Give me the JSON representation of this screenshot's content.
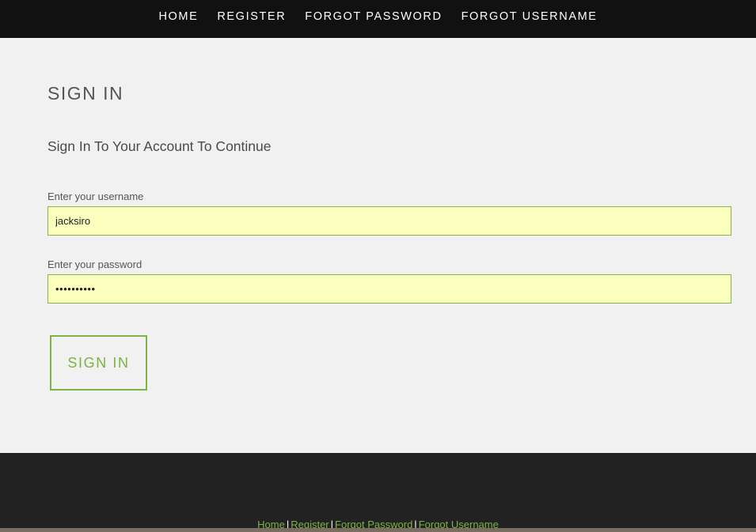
{
  "nav": {
    "items": [
      {
        "label": "HOME"
      },
      {
        "label": "REGISTER"
      },
      {
        "label": "FORGOT PASSWORD"
      },
      {
        "label": "FORGOT USERNAME"
      }
    ]
  },
  "main": {
    "title": "SIGN IN",
    "subtitle": "Sign In To Your Account To Continue",
    "username": {
      "label": "Enter your username",
      "value": "jacksiro"
    },
    "password": {
      "label": "Enter your password",
      "value": "••••••••••"
    },
    "submit_label": "SIGN IN"
  },
  "footer": {
    "links": [
      {
        "label": "Home"
      },
      {
        "label": "Register"
      },
      {
        "label": "Forgot Password"
      },
      {
        "label": "Forgot Username"
      }
    ],
    "separator": "|"
  },
  "colors": {
    "nav_bg": "#111111",
    "page_bg": "#f1f1f1",
    "accent": "#7cb342",
    "autofill_bg": "#faffbd",
    "footer_bg": "#222222"
  }
}
